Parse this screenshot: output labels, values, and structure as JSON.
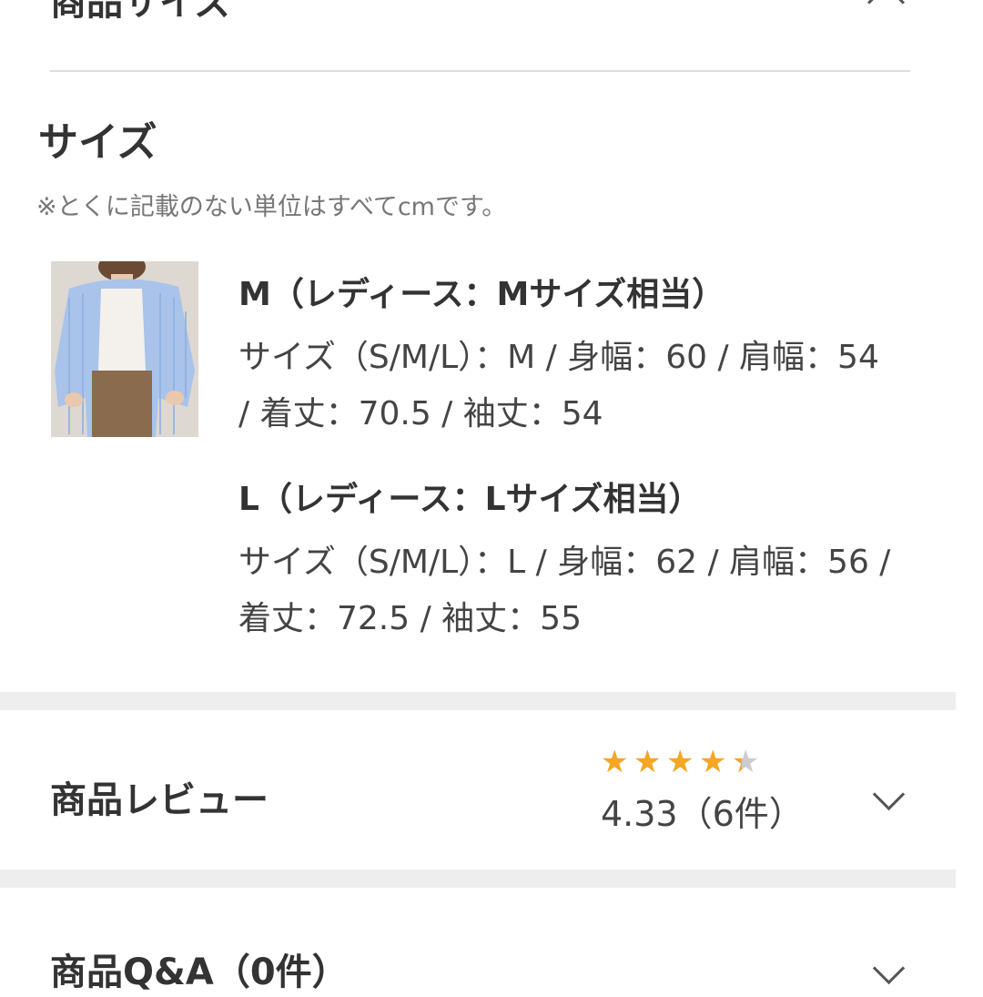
{
  "size_section": {
    "title": "商品サイズ",
    "subtitle": "サイズ",
    "note": "※とくに記載のない単位はすべてcmです。",
    "variants": [
      {
        "title": "M（レディース：Mサイズ相当）",
        "spec": "サイズ（S/M/L）：M / 身幅：60 / 肩幅：54 / 着丈：70.5 / 袖丈：54"
      },
      {
        "title": "L（レディース：Lサイズ相当）",
        "spec": "サイズ（S/M/L）：L / 身幅：62 / 肩幅：56 / 着丈：72.5 / 袖丈：55"
      }
    ]
  },
  "review_section": {
    "label": "商品レビュー",
    "rating": 4.33,
    "rating_text": "4.33（6件）",
    "star_color": "#f5a623"
  },
  "qa_section": {
    "label": "商品Q&A（0件）"
  },
  "icons": {
    "collapse": "chevron-up-icon",
    "expand": "chevron-down-icon",
    "star": "star-icon"
  }
}
